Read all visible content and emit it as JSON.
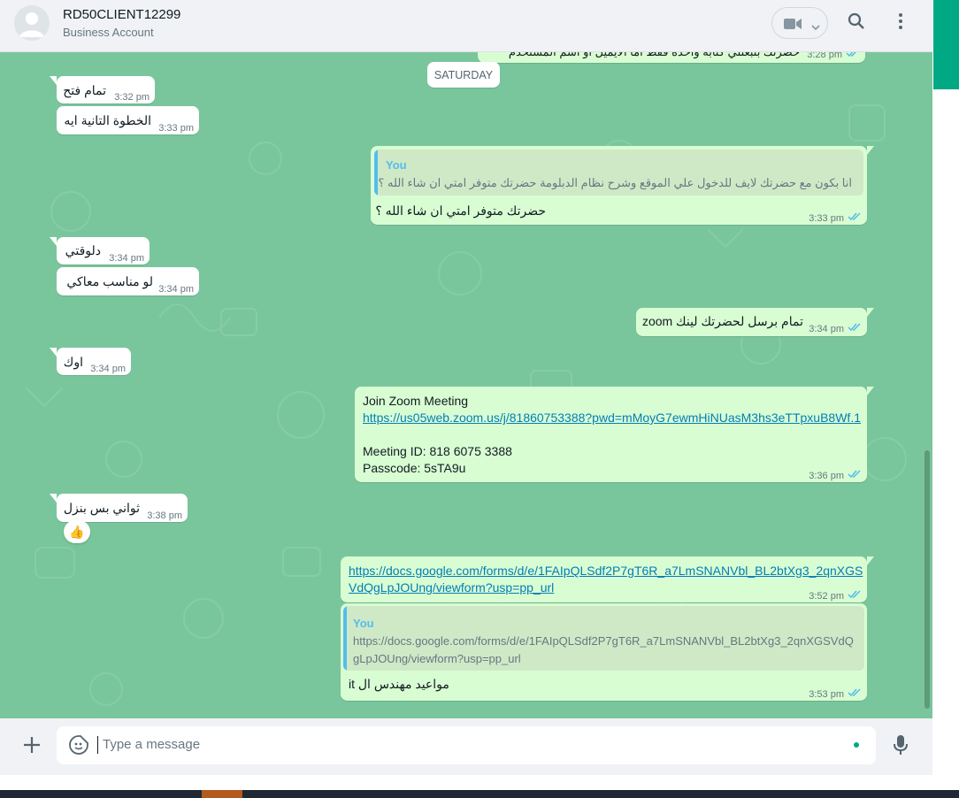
{
  "header": {
    "contact_name": "RD50CLIENT12299",
    "contact_subtitle": "Business Account"
  },
  "chat": {
    "date_separator": "SATURDAY",
    "top_partial": {
      "text": "حضرتك بتبعتلي كتابة واحدة فقط اما الايميل او اسم المستخدم",
      "time": "3:28 pm"
    },
    "messages": [
      {
        "id": "m1",
        "direction": "in",
        "text": "تمام فتح",
        "time": "3:32 pm"
      },
      {
        "id": "m2",
        "direction": "in",
        "text": "الخطوة التانية ايه",
        "time": "3:33 pm"
      },
      {
        "id": "m3",
        "direction": "out",
        "quote_author": "You",
        "quote_text": "انا بكون مع حضرتك لايف للدخول علي الموقع وشرح نظام الدبلومة حضرتك متوفر امتي ان شاء الله ؟",
        "text": "حضرتك متوفر امتي ان شاء الله ؟",
        "time": "3:33 pm"
      },
      {
        "id": "m4",
        "direction": "in",
        "text": "دلوقتي",
        "time": "3:34 pm"
      },
      {
        "id": "m5",
        "direction": "in",
        "text": "لو مناسب معاكي",
        "time": "3:34 pm"
      },
      {
        "id": "m6",
        "direction": "out",
        "text": "تمام برسل لحضرتك لينك zoom",
        "time": "3:34 pm"
      },
      {
        "id": "m7",
        "direction": "in",
        "text": "اوك",
        "time": "3:34 pm"
      },
      {
        "id": "m8",
        "direction": "out",
        "line1": "Join Zoom Meeting",
        "link": "https://us05web.zoom.us/j/81860753388?pwd=mMoyG7ewmHiNUasM3hs3eTTpxuB8Wf.1",
        "line3": "Meeting ID: 818 6075 3388",
        "line4": "Passcode: 5sTA9u",
        "time": "3:36 pm"
      },
      {
        "id": "m9",
        "direction": "in",
        "text": "ثواني بس بنزل",
        "time": "3:38 pm",
        "reaction": "👍"
      },
      {
        "id": "m10",
        "direction": "out",
        "link_line1": "https://docs.google.com/forms/d/e/1FAIpQLSdf2P7gT6R_a7LmSNANVbl_BL2btXg3_2qnXGS",
        "link_line2": "VdQgLpJOUng/viewform?usp=pp_url",
        "time": "3:52 pm"
      },
      {
        "id": "m11",
        "direction": "out",
        "quote_author": "You",
        "quote_line1": "https://docs.google.com/forms/d/e/1FAIpQLSdf2P7gT6R_a7LmSNANVbl_BL2btXg3_2qnXGSVdQ",
        "quote_line2": "gLpJOUng/viewform?usp=pp_url",
        "text": "مواعيد مهندس ال  it",
        "time": "3:53 pm"
      }
    ]
  },
  "composer": {
    "placeholder": "Type a message"
  },
  "icons": {
    "video": "video-camera-icon",
    "search": "search-icon",
    "menu": "more-vertical-icon",
    "attach": "plus-icon",
    "sticker": "sticker-icon",
    "mic": "microphone-icon",
    "read_receipt": "double-check-icon"
  },
  "colors": {
    "chat_background": "#7ac69c",
    "incoming_bubble": "#ffffff",
    "outgoing_bubble": "#d9fdd3",
    "read_tick": "#53bdeb",
    "accent": "#00a884"
  }
}
